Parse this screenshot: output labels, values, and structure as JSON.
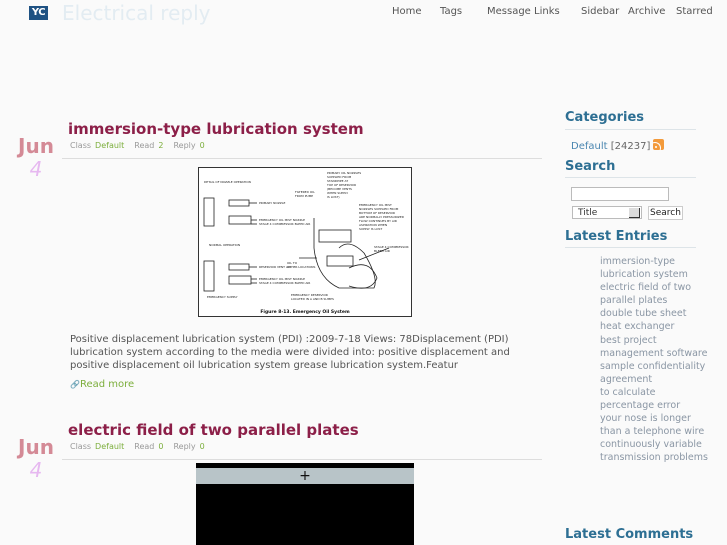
{
  "header": {
    "logo_text": "YC",
    "site_title": "Electrical reply",
    "nav": [
      "Home",
      "Tags",
      "Message",
      "Links",
      "Sidebar",
      "Archive",
      "Starred"
    ]
  },
  "posts": [
    {
      "month": "Jun",
      "day": "4",
      "title": "immersion-type lubrication system",
      "meta": {
        "class_label": "Class",
        "class_value": "Default",
        "read_label": "Read",
        "read_value": "2",
        "reply_label": "Reply",
        "reply_value": "0"
      },
      "figure_caption": "Figure 8-13. Emergency Oil System",
      "body": "Positive displacement lubrication system (PDI) :2009-7-18 Views: 78Displacement (PDI) lubrication system according to the media were divided into: positive displacement and positive displacement oil lubrication system grease lubrication system.Featur",
      "read_more": "Read more"
    },
    {
      "month": "Jun",
      "day": "4",
      "title": "electric field of two parallel plates",
      "meta": {
        "class_label": "Class",
        "class_value": "Default",
        "read_label": "Read",
        "read_value": "0",
        "reply_label": "Reply",
        "reply_value": "0"
      },
      "video_symbol": "+"
    }
  ],
  "sidebar": {
    "categories_heading": "Categories",
    "category": {
      "name": "Default",
      "count": "[24237]"
    },
    "search_heading": "Search",
    "search_input_value": "",
    "search_select_value": "Title",
    "search_button": "Search",
    "latest_entries_heading": "Latest Entries",
    "latest_entries": [
      "immersion-type lubrication system",
      "electric field of two parallel plates",
      "double tube sheet heat exchanger",
      "best project management software",
      "sample confidentiality agreement",
      "to calculate percentage error",
      "your nose is longer than a telephone wire",
      "continuously variable transmission problems"
    ],
    "latest_comments_heading": "Latest Comments"
  },
  "colors": {
    "accent_title": "#8c1f48",
    "sidebar_heading": "#2d6f93",
    "meta_value": "#7cae3c",
    "logo_bg": "#1f5283"
  }
}
